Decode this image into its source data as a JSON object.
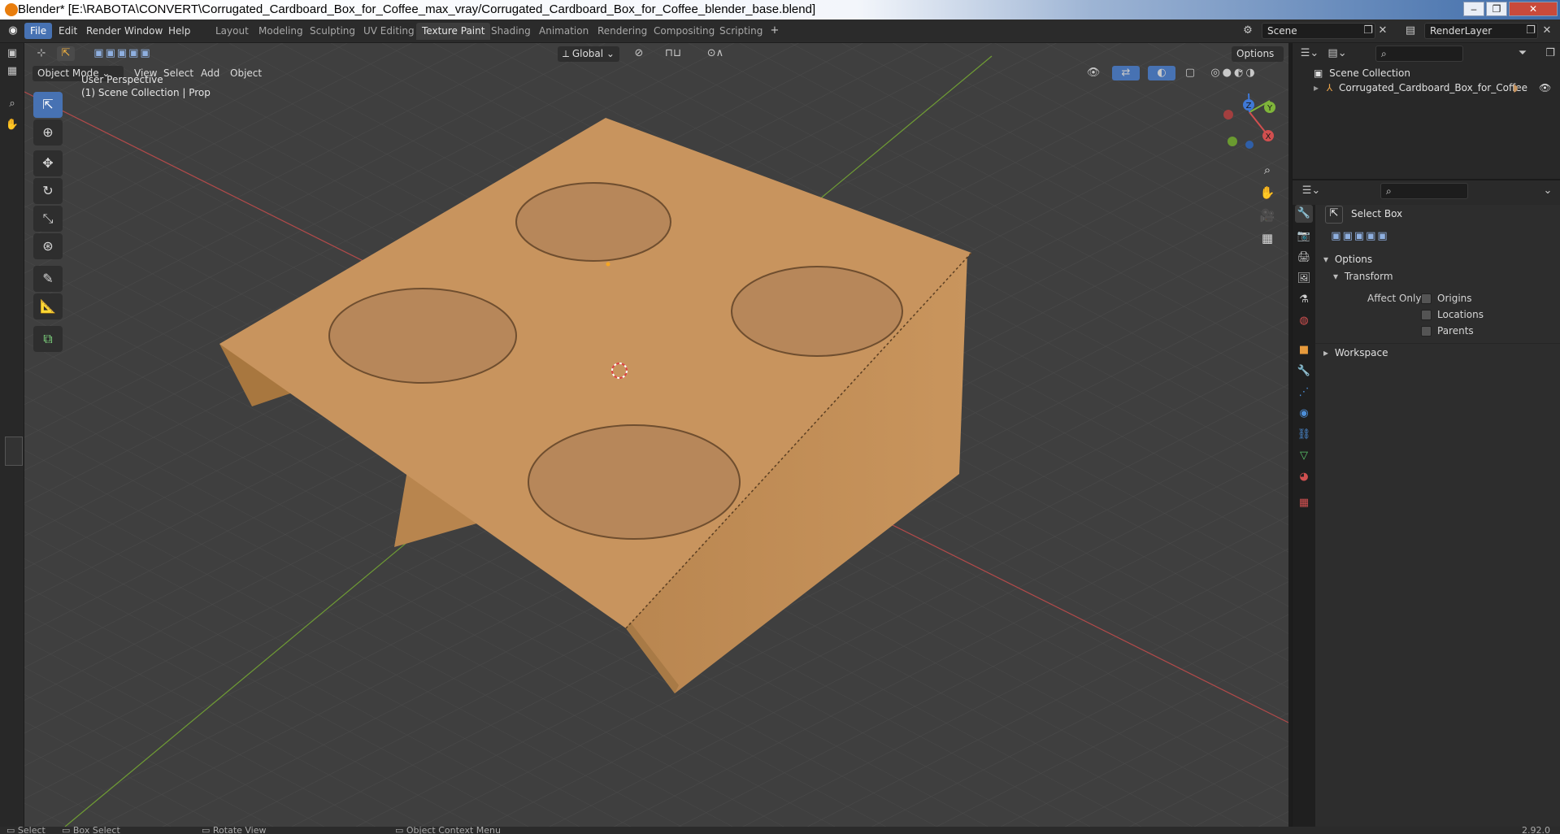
{
  "window": {
    "title": "Blender* [E:\\RABOTA\\CONVERT\\Corrugated_Cardboard_Box_for_Coffee_max_vray/Corrugated_Cardboard_Box_for_Coffee_blender_base.blend]",
    "controls": [
      "–",
      "❐",
      "✕"
    ]
  },
  "menu": [
    "File",
    "Edit",
    "Render",
    "Window",
    "Help"
  ],
  "workspaces": [
    "Layout",
    "Modeling",
    "Sculpting",
    "UV Editing",
    "Texture Paint",
    "Shading",
    "Animation",
    "Rendering",
    "Compositing",
    "Scripting"
  ],
  "active_workspace": "Texture Paint",
  "scene_field": "Scene",
  "renderlayer_field": "RenderLayer",
  "viewport": {
    "mode": "Object Mode",
    "menus": [
      "View",
      "Select",
      "Add",
      "Object"
    ],
    "orientation": "Global",
    "options_label": "Options",
    "perspective_text": "User Perspective",
    "collection_text": "(1) Scene Collection | Prop",
    "gizmo_axes": {
      "x": "X",
      "y": "Y",
      "z": "Z"
    },
    "tools": [
      "select-box",
      "cursor",
      "move",
      "rotate",
      "scale",
      "transform",
      "annotate",
      "measure",
      "add-cube"
    ]
  },
  "outliner": {
    "root": "Scene Collection",
    "items": [
      "Corrugated_Cardboard_Box_for_Coffee"
    ]
  },
  "properties": {
    "tool_name": "Select Box",
    "options_header": "Options",
    "transform_header": "Transform",
    "affect_only_label": "Affect Only",
    "checkboxes": [
      "Origins",
      "Locations",
      "Parents"
    ],
    "workspace_header": "Workspace"
  },
  "statusbar": {
    "items": [
      "Select",
      "Box Select",
      "Rotate View",
      "Object Context Menu"
    ],
    "version": "2.92.0"
  },
  "colors": {
    "accent": "#4772b3",
    "viewport_bg": "#3f3f3f",
    "axis_x": "#d14f4f",
    "axis_y": "#7fb53a",
    "cardboard": "#c8945e"
  }
}
